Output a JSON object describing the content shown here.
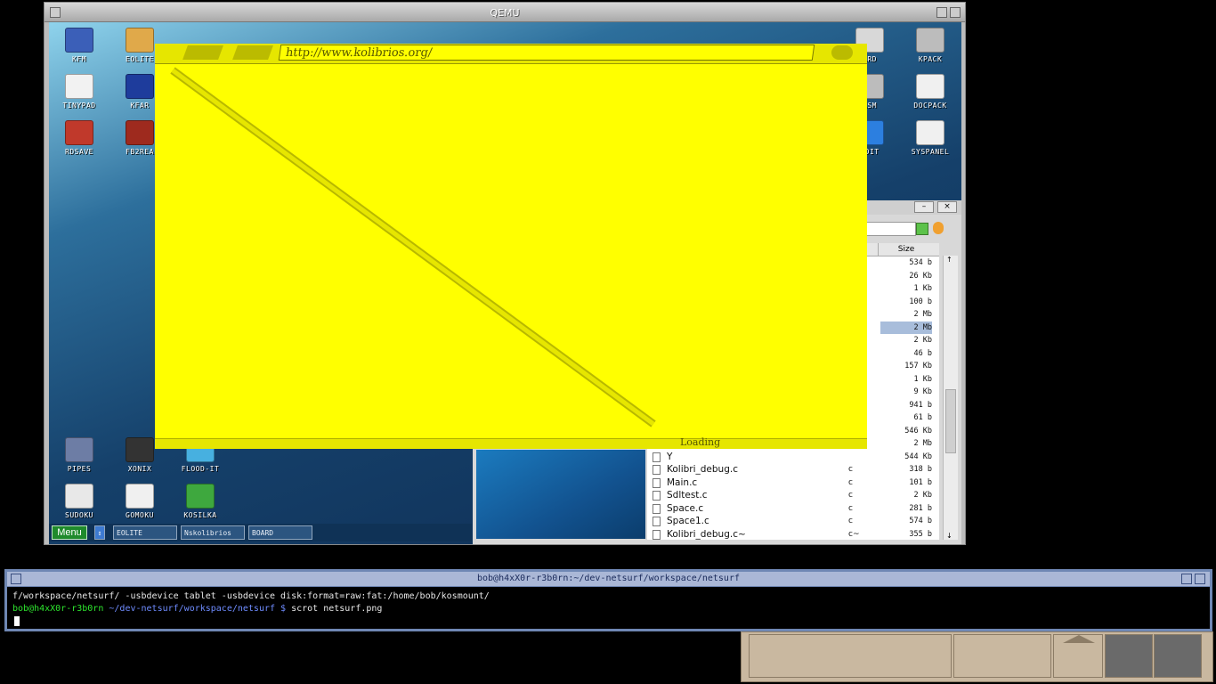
{
  "qemu": {
    "title": "QEMU"
  },
  "desktop": {
    "icons": [
      {
        "label": "KFM",
        "color": "#3b5fb8"
      },
      {
        "label": "EOLITE",
        "color": "#e0a94a"
      },
      {
        "label": "TINYPAD",
        "color": "#f2f2f2"
      },
      {
        "label": "KFAR",
        "color": "#1e3c9c"
      },
      {
        "label": "RDSAVE",
        "color": "#c0392b"
      },
      {
        "label": "FB2REA",
        "color": "#9e2a1e"
      },
      {
        "label": "PIPES",
        "color": "#6d7da5"
      },
      {
        "label": "XONIX",
        "color": "#333333"
      },
      {
        "label": "FLOOD-IT",
        "color": "#47b0e0"
      },
      {
        "label": "SUDOKU",
        "color": "#e8e8e8"
      },
      {
        "label": "GOMOKU",
        "color": "#f0f0f0"
      },
      {
        "label": "KOSILKA",
        "color": "#3ea83e"
      },
      {
        "label": "ARD",
        "color": "#d8d8d8"
      },
      {
        "label": "KPACK",
        "color": "#bcbcbc"
      },
      {
        "label": "ASM",
        "color": "#bcbcbc"
      },
      {
        "label": "DOCPACK",
        "color": "#f0f0f0"
      },
      {
        "label": "EDIT",
        "color": "#2c7fe0"
      },
      {
        "label": "SYSPANEL",
        "color": "#f0f0f0"
      }
    ]
  },
  "taskbar": {
    "menu_label": "Menu",
    "items": [
      "EOLITE",
      "Nskolibrios",
      "BOARD"
    ]
  },
  "file_manager": {
    "size_header": "Size",
    "rows": [
      {
        "name": "",
        "ext": "",
        "size": "534 b"
      },
      {
        "name": "",
        "ext": "",
        "size": "26 Kb"
      },
      {
        "name": "",
        "ext": "",
        "size": "1 Kb"
      },
      {
        "name": "",
        "ext": "",
        "size": "100 b"
      },
      {
        "name": "",
        "ext": "",
        "size": "2 Mb"
      },
      {
        "name": "",
        "ext": "",
        "size": "2 Mb",
        "selected": true
      },
      {
        "name": "",
        "ext": "",
        "size": "2 Kb"
      },
      {
        "name": "",
        "ext": "",
        "size": "46 b"
      },
      {
        "name": "",
        "ext": "",
        "size": "157 Kb"
      },
      {
        "name": "",
        "ext": "",
        "size": "1 Kb"
      },
      {
        "name": "",
        "ext": "",
        "size": "9 Kb"
      },
      {
        "name": "",
        "ext": "",
        "size": "941 b"
      },
      {
        "name": "",
        "ext": "",
        "size": "61 b"
      },
      {
        "name": "",
        "ext": "",
        "size": "546 Kb"
      },
      {
        "name": "",
        "ext": "",
        "size": "2 Mb"
      },
      {
        "name": "Y",
        "ext": "",
        "size": "544 Kb"
      },
      {
        "name": "Kolibri_debug.c",
        "ext": "c",
        "size": "318 b"
      },
      {
        "name": "Main.c",
        "ext": "c",
        "size": "101 b"
      },
      {
        "name": "Sdltest.c",
        "ext": "c",
        "size": "2 Kb"
      },
      {
        "name": "Space.c",
        "ext": "c",
        "size": "281 b"
      },
      {
        "name": "Space1.c",
        "ext": "c",
        "size": "574 b"
      },
      {
        "name": "Kolibri_debug.c~",
        "ext": "c~",
        "size": "355 b"
      }
    ]
  },
  "netsurf": {
    "url": "http://www.kolibrios.org/",
    "status": "Loading",
    "background": "#ffff00"
  },
  "terminal": {
    "title": "bob@h4xX0r-r3b0rn:~/dev-netsurf/workspace/netsurf",
    "line1": "f/workspace/netsurf/ -usbdevice tablet -usbdevice disk:format=raw:fat:/home/bob/kosmount/",
    "prompt_user": "bob@h4xX0r-r3b0rn",
    "prompt_path": " ~/dev-netsurf/workspace/netsurf $",
    "command": " scrot netsurf.png"
  }
}
